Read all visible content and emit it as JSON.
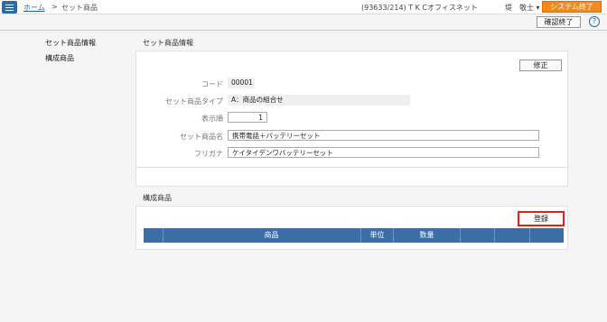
{
  "header": {
    "home_link": "ホーム",
    "separator": ">",
    "current_page": "セット商品",
    "user_info": "(93633/214) T K Cオフィスネット",
    "user_name": "堤　敬士 ▾",
    "system_exit": "システム終了",
    "confirm_exit": "確認終了",
    "help": "?"
  },
  "sidebar": {
    "items": [
      {
        "label": "セット商品情報"
      },
      {
        "label": "構成商品"
      }
    ]
  },
  "set_info": {
    "title": "セット商品情報",
    "edit_button": "修正",
    "fields": {
      "code_label": "コード",
      "code_value": "00001",
      "type_label": "セット商品タイプ",
      "type_value": "A：商品の組合せ",
      "order_label": "表示順",
      "order_value": "1",
      "name_label": "セット商品名",
      "name_value": "携帯電話＋バッテリーセット",
      "kana_label": "フリガナ",
      "kana_value": "ケイタイデンワバッテリーセット"
    }
  },
  "components": {
    "title": "構成商品",
    "register_button": "登録",
    "columns": [
      "",
      "商品",
      "単位",
      "数量",
      "",
      "",
      ""
    ]
  },
  "colors": {
    "accent": "#3a6ea5",
    "system_exit": "#f38a1f",
    "highlight": "#e02020"
  }
}
